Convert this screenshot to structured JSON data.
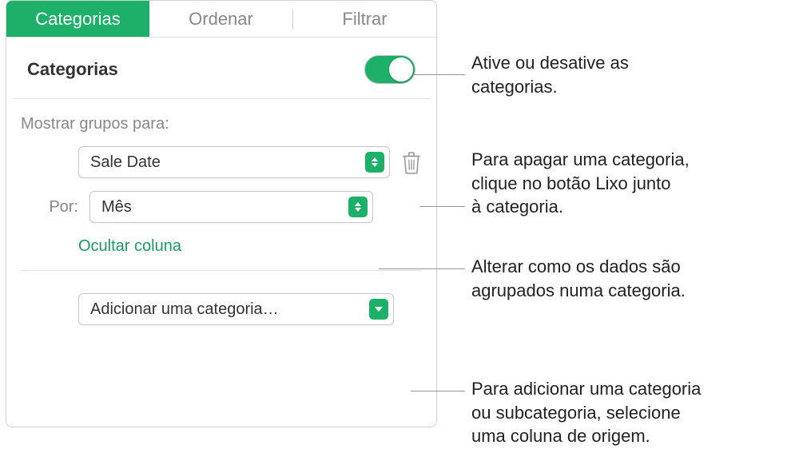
{
  "tabs": {
    "categories": "Categorias",
    "sort": "Ordenar",
    "filter": "Filtrar"
  },
  "header": {
    "title": "Categorias"
  },
  "labels": {
    "show_groups_for": "Mostrar grupos para:",
    "por": "Por:",
    "hide_column": "Ocultar coluna"
  },
  "selects": {
    "group_column": "Sale Date",
    "group_by": "Mês",
    "add_category": "Adicionar uma categoria…"
  },
  "callouts": {
    "toggle": "Ative ou desative as categorias.",
    "trash_line1": "Para apagar uma categoria,",
    "trash_line2": "clique no botão Lixo junto",
    "trash_line3": "à categoria.",
    "groupby_line1": "Alterar como os dados são",
    "groupby_line2": "agrupados numa categoria.",
    "add_line1": "Para adicionar uma categoria",
    "add_line2": "ou subcategoria, selecione",
    "add_line3": "uma coluna de origem."
  }
}
